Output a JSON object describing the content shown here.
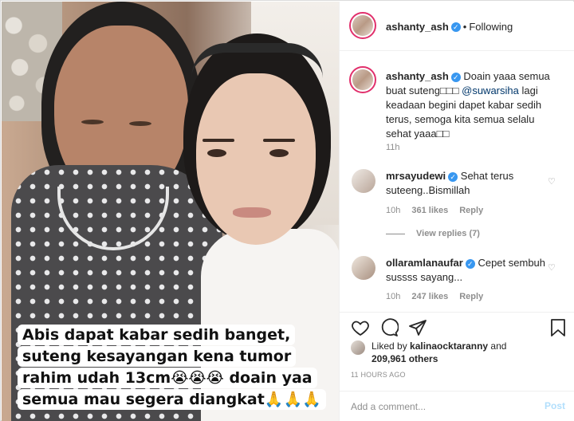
{
  "post_image": {
    "caption_lines": [
      "Abis dapat kabar sedih banget,",
      "suteng kesayangan kena tumor",
      "rahim udah 13cm😭😭😭 doain yaa",
      "semua mau segera diangkat🙏🙏🙏"
    ]
  },
  "header": {
    "username": "ashanty_ash",
    "separator": "•",
    "follow_status": "Following",
    "verified_icon": "verified-badge-icon"
  },
  "caption_comment": {
    "username": "ashanty_ash",
    "text_before_mention": "Doain yaaa semua buat suteng□□□ ",
    "mention": "@suwarsiha",
    "text_after_mention": " lagi keadaan begini dapet kabar sedih terus, semoga kita semua selalu sehat yaaa□□",
    "time": "11h"
  },
  "comments": [
    {
      "username": "mrsayudewi",
      "text": "Sehat terus suteeng..Bismillah",
      "time": "10h",
      "likes": "361 likes",
      "reply_label": "Reply",
      "view_replies": "View replies (7)"
    },
    {
      "username": "ollaramlanaufar",
      "text": "Cepet sembuh sussss sayang...",
      "time": "10h",
      "likes": "247 likes",
      "reply_label": "Reply"
    }
  ],
  "actions": {
    "icons": [
      "heart-icon",
      "comment-icon",
      "share-icon",
      "bookmark-icon"
    ]
  },
  "likes": {
    "prefix": "Liked by ",
    "user": "kalinaocktaranny",
    "middle": " and",
    "count": "209,961 others"
  },
  "timestamp": "11 HOURS AGO",
  "add_comment": {
    "placeholder": "Add a comment...",
    "post_label": "Post"
  },
  "colors": {
    "verified": "#3897f0",
    "link": "#00376b",
    "muted": "#8e8e8e",
    "post_disabled": "#b2dffc",
    "story_ring": "#e1306c"
  }
}
